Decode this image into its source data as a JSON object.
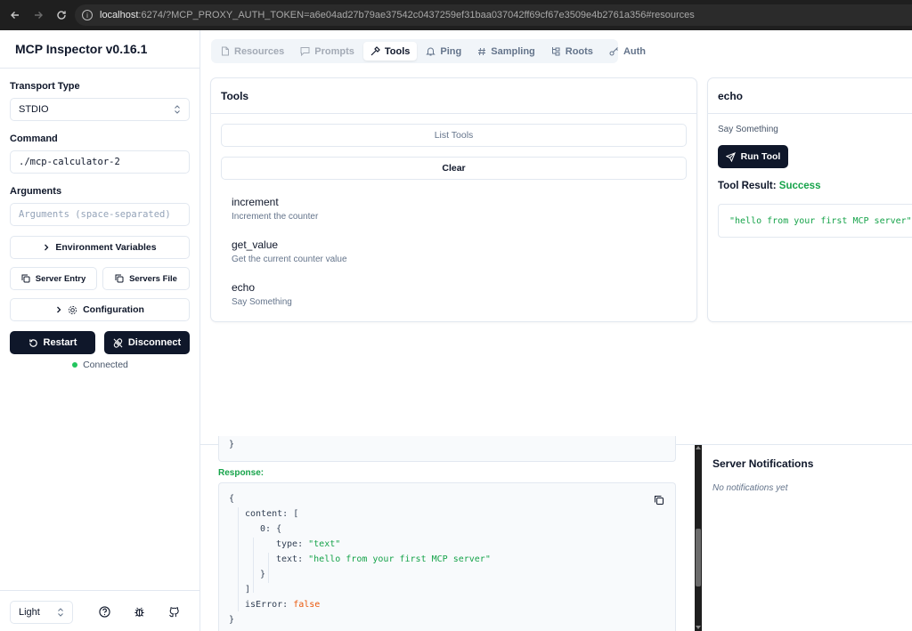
{
  "browser": {
    "url_host": "localhost",
    "url_path": ":6274/?MCP_PROXY_AUTH_TOKEN=a6e04ad27b79ae37542c0437259ef31baa037042ff69cf67e3509e4b2761a356#resources"
  },
  "sidebar": {
    "title": "MCP Inspector v0.16.1",
    "transport_label": "Transport Type",
    "transport_value": "STDIO",
    "command_label": "Command",
    "command_value": "./mcp-calculator-2",
    "arguments_label": "Arguments",
    "arguments_placeholder": "Arguments (space-separated)",
    "env_button": "Environment Variables",
    "server_entry_button": "Server Entry",
    "servers_file_button": "Servers File",
    "configuration_button": "Configuration",
    "restart_button": "Restart",
    "disconnect_button": "Disconnect",
    "status_text": "Connected",
    "status_color": "#22c55e",
    "theme_value": "Light"
  },
  "tabs": [
    {
      "label": "Resources",
      "icon": "file-icon",
      "state": "disabled"
    },
    {
      "label": "Prompts",
      "icon": "message-icon",
      "state": "disabled"
    },
    {
      "label": "Tools",
      "icon": "hammer-icon",
      "state": "active"
    },
    {
      "label": "Ping",
      "icon": "bell-icon",
      "state": "normal"
    },
    {
      "label": "Sampling",
      "icon": "hash-icon",
      "state": "normal"
    },
    {
      "label": "Roots",
      "icon": "folder-tree-icon",
      "state": "normal"
    },
    {
      "label": "Auth",
      "icon": "key-icon",
      "state": "normal"
    }
  ],
  "tools_card": {
    "title": "Tools",
    "list_button": "List Tools",
    "clear_button": "Clear",
    "items": [
      {
        "name": "increment",
        "description": "Increment the counter"
      },
      {
        "name": "get_value",
        "description": "Get the current counter value"
      },
      {
        "name": "echo",
        "description": "Say Something"
      }
    ]
  },
  "echo_card": {
    "title": "echo",
    "description": "Say Something",
    "run_button": "Run Tool",
    "result_label": "Tool Result:",
    "result_status": "Success",
    "result_text": "\"hello from your first MCP server\""
  },
  "response": {
    "label": "Response:",
    "prev_closing": "}",
    "lines": {
      "open": "{",
      "content_key": "content:",
      "content_open": "[",
      "idx_key": "0:",
      "idx_open": "{",
      "type_key": "type:",
      "type_val": "\"text\"",
      "text_key": "text:",
      "text_val": "\"hello from your first MCP server\"",
      "idx_close": "}",
      "content_close": "]",
      "iserror_key": "isError:",
      "iserror_val": "false",
      "close": "}"
    }
  },
  "notifications": {
    "title": "Server Notifications",
    "empty": "No notifications yet"
  }
}
